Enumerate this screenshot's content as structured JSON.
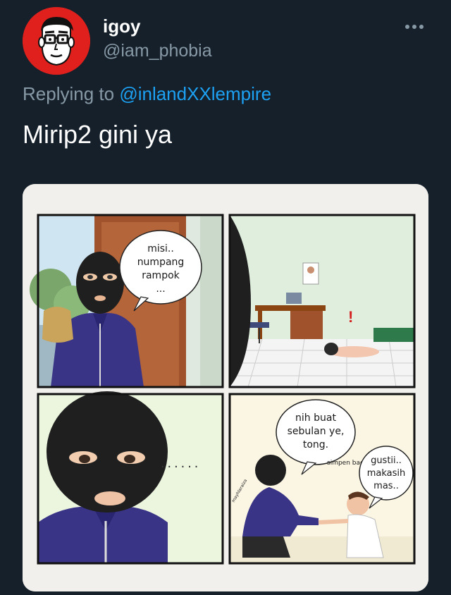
{
  "user": {
    "display_name": "igoy",
    "handle": "@iam_phobia"
  },
  "reply": {
    "prefix": "Replying to ",
    "mention": "@inlandXXlempire"
  },
  "tweet": {
    "text": "Mirip2 gini ya"
  },
  "comic": {
    "panel1_bubble": [
      "misi..",
      "numpang",
      "rampok",
      "..."
    ],
    "panel2_exclaim": "!",
    "panel3_dots": "......",
    "panel4_bubble_main": [
      "nih buat",
      "sebulan ye,",
      "tong."
    ],
    "panel4_aside": "simpen bae2",
    "panel4_reply": [
      "gustii..",
      "makasih",
      "mas.."
    ],
    "signature": "mayhlaraiza"
  },
  "colors": {
    "background": "#15202b",
    "secondary_text": "#8899a6",
    "link": "#1da1f2",
    "avatar_bg": "#e0201c"
  },
  "icons": {
    "more": "more-horizontal-icon"
  }
}
